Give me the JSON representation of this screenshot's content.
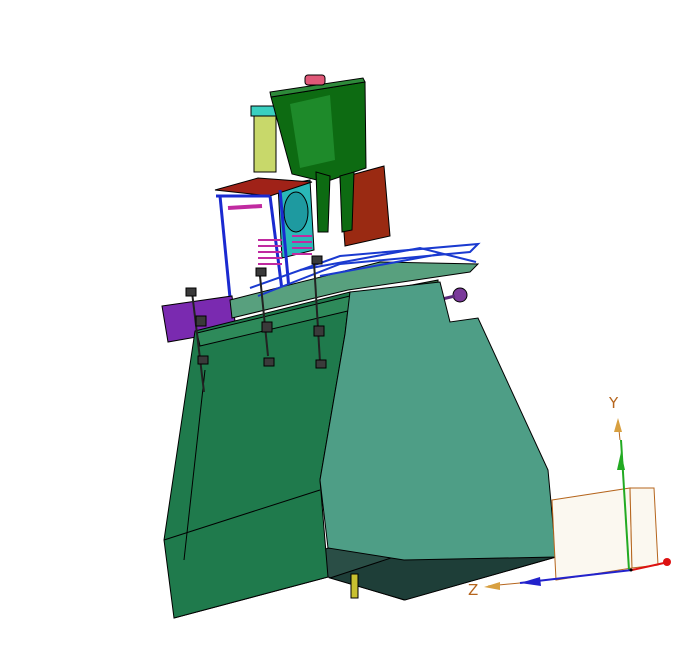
{
  "view": {
    "axes": {
      "y_label": "Y",
      "z_label": "Z",
      "y_color": "#22aa22",
      "z_color": "#2222cc",
      "x_color": "#dd1111",
      "label_color": "#b5651d"
    },
    "model_colors": {
      "hopper_body": "#4e9e86",
      "hopper_front": "#1f7a4c",
      "hopper_bottom": "#2a4e46",
      "funnel": "#0d6b12",
      "panel_red": "#9a2a12",
      "frame_blue": "#1a2ad0",
      "spring_magenta": "#c02aa0",
      "cyan_part": "#2ab8b8",
      "purple_part": "#7a2ab0",
      "yellow_cyl": "#c8d86a",
      "motor_box": "#3a6e48"
    },
    "icons": [
      "part-icon-hopper",
      "part-icon-funnel",
      "triad-icon"
    ]
  }
}
